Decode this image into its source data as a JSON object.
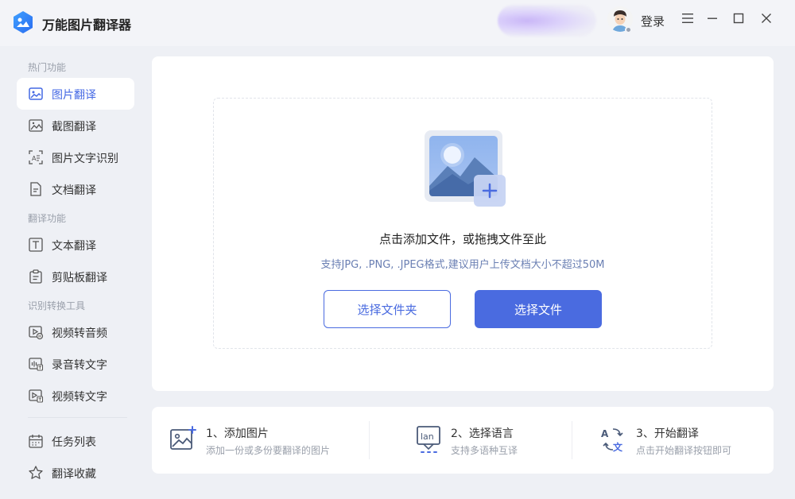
{
  "app": {
    "title": "万能图片翻译器"
  },
  "header": {
    "login_label": "登录"
  },
  "sidebar": {
    "sections": [
      {
        "label": "热门功能"
      },
      {
        "label": "翻译功能"
      },
      {
        "label": "识别转换工具"
      }
    ],
    "items": [
      {
        "label": "图片翻译",
        "icon": "image-icon",
        "active": true
      },
      {
        "label": "截图翻译",
        "icon": "screenshot-icon"
      },
      {
        "label": "图片文字识别",
        "icon": "ocr-icon"
      },
      {
        "label": "文档翻译",
        "icon": "document-icon"
      },
      {
        "label": "文本翻译",
        "icon": "text-icon"
      },
      {
        "label": "剪贴板翻译",
        "icon": "clipboard-icon"
      },
      {
        "label": "视频转音频",
        "icon": "video-audio-icon"
      },
      {
        "label": "录音转文字",
        "icon": "recording-text-icon"
      },
      {
        "label": "视频转文字",
        "icon": "video-text-icon"
      },
      {
        "label": "任务列表",
        "icon": "calendar-icon"
      },
      {
        "label": "翻译收藏",
        "icon": "star-icon"
      }
    ]
  },
  "upload": {
    "title": "点击添加文件，或拖拽文件至此",
    "hint": "支持JPG, .PNG, .JPEG格式,建议用户上传文档大小不超过50M",
    "folder_button": "选择文件夹",
    "file_button": "选择文件"
  },
  "steps": [
    {
      "title": "1、添加图片",
      "desc": "添加一份或多份要翻译的图片",
      "icon": "add-image-icon"
    },
    {
      "title": "2、选择语言",
      "desc": "支持多语种互译",
      "icon": "language-icon"
    },
    {
      "title": "3、开始翻译",
      "desc": "点击开始翻译按钮即可",
      "icon": "translate-icon"
    }
  ],
  "colors": {
    "accent": "#4a6be0",
    "active_text": "#4468e4",
    "background": "#eef0f5"
  }
}
